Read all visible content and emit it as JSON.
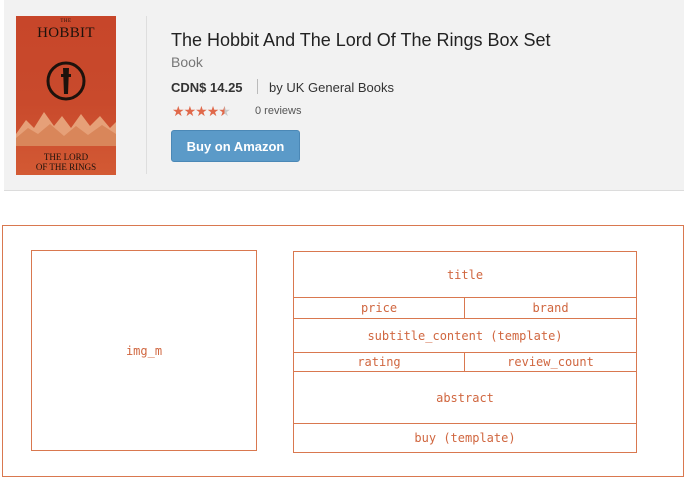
{
  "product": {
    "cover": {
      "top_text": "THE",
      "title_text": "HOBBIT",
      "bottom_line1": "THE LORD",
      "bottom_line2": "OF THE RINGS",
      "accent": "#c7462a"
    },
    "title": "The Hobbit And The Lord Of The Rings Box Set",
    "subtitle": "Book",
    "price": "CDN$ 14.25",
    "brand": "by UK General Books",
    "rating": 4.5,
    "rating_max": 5,
    "reviews": "0 reviews",
    "buy_label": "Buy on Amazon",
    "buy_color": "#5b9ac8",
    "star_color": "#e0694b"
  },
  "template": {
    "border_color": "#d9784f",
    "image_label": "img_m",
    "title_label": "title",
    "price_label": "price",
    "brand_label": "brand",
    "subtitle_label": "subtitle_content (template)",
    "rating_label": "rating",
    "review_count_label": "review_count",
    "abstract_label": "abstract",
    "buy_label": "buy (template)"
  }
}
